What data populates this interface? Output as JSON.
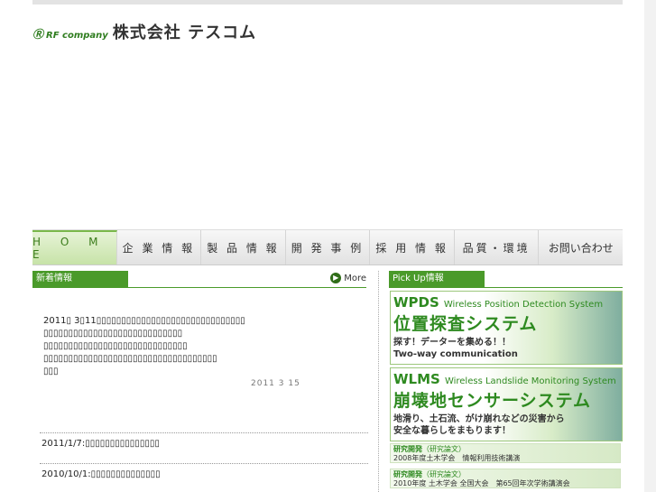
{
  "logo": {
    "mark": "Ⓡ",
    "rf": "RF company",
    "name": "株式会社 テスコム"
  },
  "nav": [
    "H O M E",
    "企 業 情 報",
    "製 品 情 報",
    "開 発 事 例",
    "採 用 情 報",
    "品質・環境",
    "お問い合わせ"
  ],
  "news": {
    "heading": "新着情報",
    "more_label": "More",
    "main_lines": [
      "2011▯ 3▯11▯▯▯▯▯▯▯▯▯▯▯▯▯▯▯▯▯▯▯▯▯▯▯▯▯▯▯▯▯▯",
      "▯▯▯▯▯▯▯▯▯▯▯▯▯▯▯▯▯▯▯▯▯▯▯▯▯▯▯▯",
      "▯▯▯▯▯▯▯▯▯▯▯▯▯▯▯▯▯▯▯▯▯▯▯▯▯▯▯▯▯",
      "▯▯▯▯▯▯▯▯▯▯▯▯▯▯▯▯▯▯▯▯▯▯▯▯▯▯▯▯▯▯▯▯▯▯▯",
      "▯▯▯"
    ],
    "main_date": "2011  3 15",
    "items": [
      "2011/1/7:▯▯▯▯▯▯▯▯▯▯▯▯▯▯▯",
      "2010/10/1:▯▯▯▯▯▯▯▯▯▯▯▯▯▯"
    ]
  },
  "pickup": {
    "heading": "Pick Up情報",
    "banners": [
      {
        "code": "WPDS",
        "en": "Wireless Position Detection System",
        "ja": "位置探査システム",
        "sub1": "探す！データーを集める！！",
        "sub2": "Two-way communication"
      },
      {
        "code": "WLMS",
        "en": "Wireless Landslide Monitoring System",
        "ja": "崩壊地センサーシステム",
        "sub1": "地滑り、土石流、がけ崩れなどの災害から",
        "sub2": "安全な暮らしをまもります！"
      }
    ],
    "small": [
      {
        "title": "研究開発",
        "tag": "（研究論文）",
        "text": "2008年度土木学会　情報利用技術講演"
      },
      {
        "title": "研究開発",
        "tag": "（研究論文）",
        "text": "2010年度 土木学会 全国大会　第65回年次学術講演会"
      }
    ]
  },
  "colors": {
    "accent": "#4a9a2a",
    "banner_text": "#2e8a20"
  }
}
